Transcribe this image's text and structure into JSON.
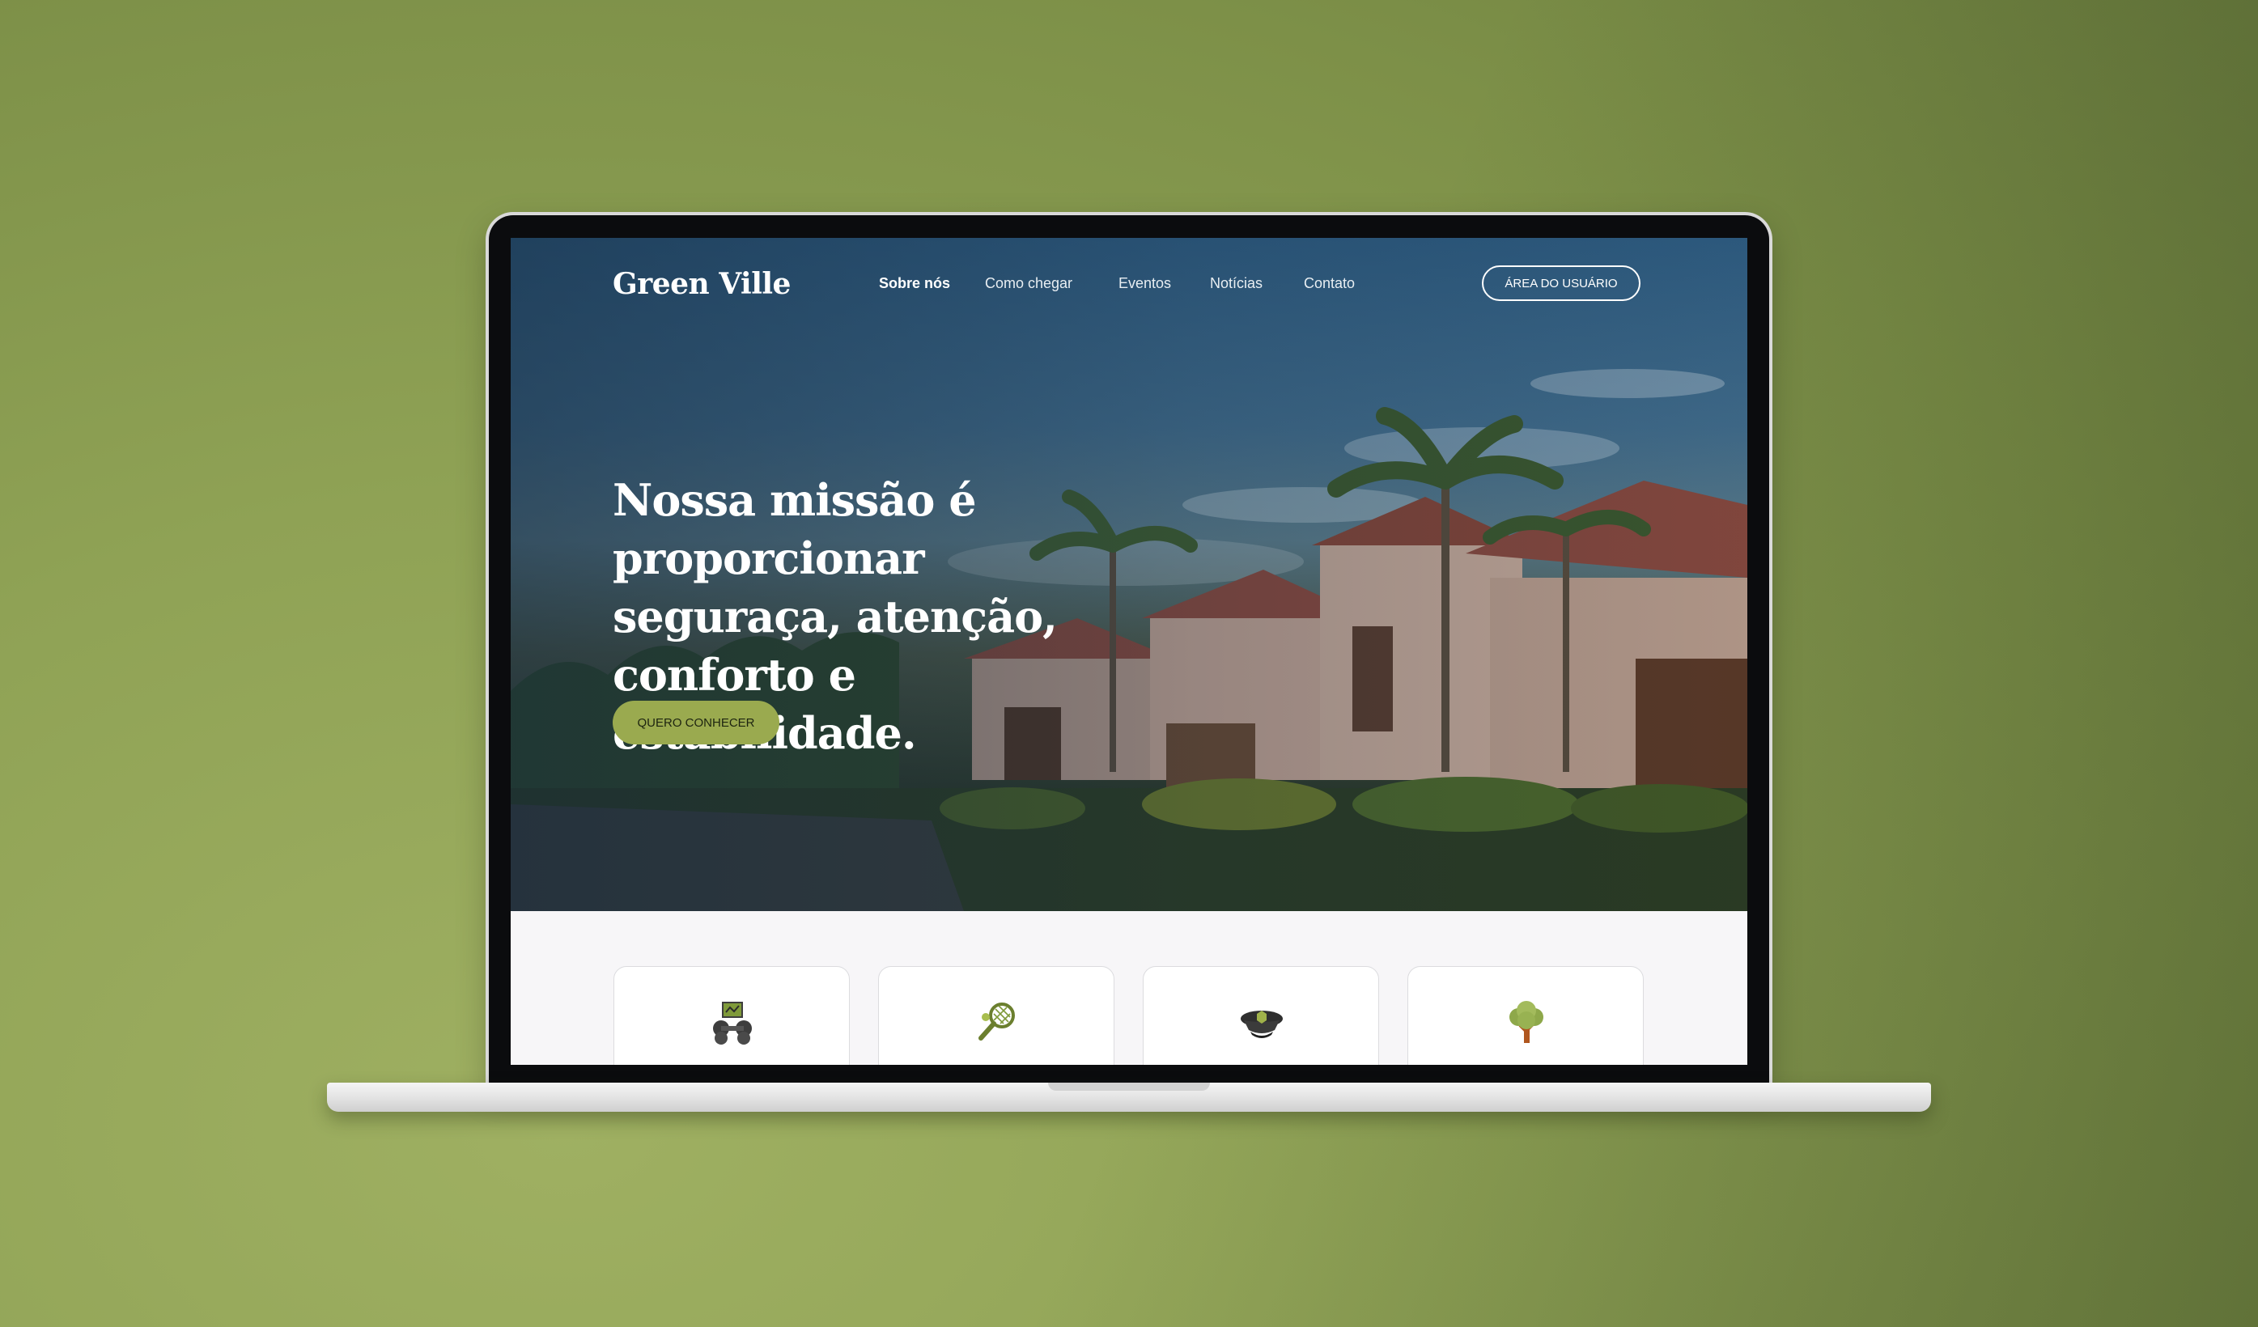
{
  "site": {
    "logo": "Green Ville",
    "nav": [
      {
        "label": "Sobre nós",
        "active": true
      },
      {
        "label": "Como chegar",
        "active": false
      },
      {
        "label": "Eventos",
        "active": false
      },
      {
        "label": "Notícias",
        "active": false
      },
      {
        "label": "Contato",
        "active": false
      }
    ],
    "user_area_button": "ÁREA DO USUÁRIO",
    "hero": {
      "headline_lines": [
        "Nossa missão é proporcionar",
        "seguraça, atenção, conforto e",
        "estabilidade."
      ],
      "cta_label": "QUERO CONHECER"
    },
    "feature_cards": [
      {
        "icon": "gym-dumbbell-icon"
      },
      {
        "icon": "tennis-racket-icon"
      },
      {
        "icon": "security-guard-cap-icon"
      },
      {
        "icon": "tree-icon"
      }
    ]
  },
  "colors": {
    "background": "#8fa255",
    "accent_button": "#9aaa4f",
    "hero_sky": "#2f5f86",
    "screen_background": "#f7f6f8"
  }
}
